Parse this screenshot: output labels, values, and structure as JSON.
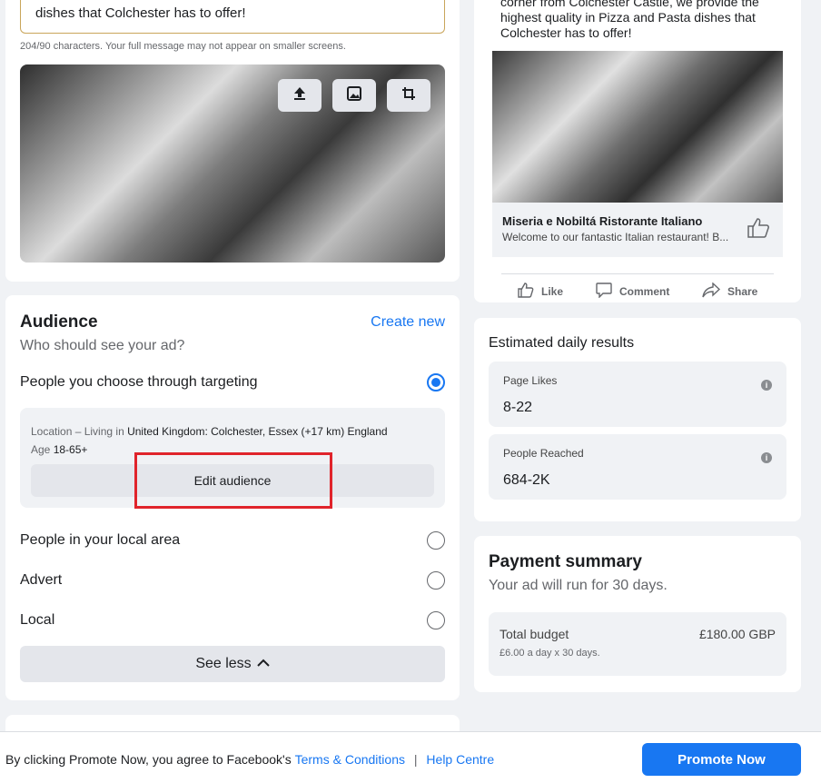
{
  "ad_editor": {
    "message_text": "dishes that Colchester has to offer!",
    "char_count": "204/90 characters. Your full message may not appear on smaller screens.",
    "image_tools": [
      "upload-icon",
      "image-icon",
      "crop-icon"
    ]
  },
  "audience": {
    "title": "Audience",
    "create_new": "Create new",
    "subtitle": "Who should see your ad?",
    "options": [
      {
        "label": "People you choose through targeting",
        "selected": true
      },
      {
        "label": "People in your local area",
        "selected": false
      },
      {
        "label": "Advert",
        "selected": false
      },
      {
        "label": "Local",
        "selected": false
      }
    ],
    "location_label": "Location – Living in",
    "location_value": "United Kingdom: Colchester, Essex (+17 km) England",
    "age_label": "Age",
    "age_value": "18-65+",
    "edit_button": "Edit audience",
    "see_less": "See less"
  },
  "preview": {
    "text": "corner from Colchester Castle, we provide the highest quality in Pizza and Pasta dishes that Colchester has to offer!",
    "page_name": "Miseria e Nobiltá Ristorante Italiano",
    "description": "Welcome to our fantastic Italian restaurant! B...",
    "actions": [
      "Like",
      "Comment",
      "Share"
    ]
  },
  "results": {
    "title": "Estimated daily results",
    "metrics": [
      {
        "label": "Page Likes",
        "value": "8-22"
      },
      {
        "label": "People Reached",
        "value": "684-2K"
      }
    ]
  },
  "payment": {
    "title": "Payment summary",
    "subtitle": "Your ad will run for 30 days.",
    "budget_label": "Total budget",
    "budget_value": "£180.00 GBP",
    "budget_detail": "£6.00 a day x 30 days."
  },
  "footer": {
    "text": "By clicking Promote Now, you agree to Facebook's",
    "terms_link": "Terms & Conditions",
    "separator": "|",
    "help_link": "Help Centre",
    "promote_button": "Promote Now"
  },
  "colors": {
    "accent": "#1877f2",
    "highlight": "#e0242b",
    "background": "#f0f2f5"
  }
}
